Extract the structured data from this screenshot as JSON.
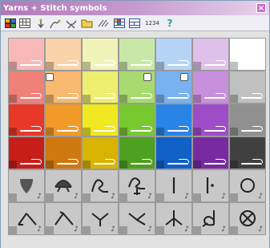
{
  "window": {
    "title": "Yarns + Stitch symbols",
    "close_glyph": "×"
  },
  "toolbar": {
    "buttons": [
      {
        "name": "palette-view-icon",
        "glyph": "▦"
      },
      {
        "name": "grid-view-icon",
        "glyph": "▩"
      },
      {
        "name": "yarn-down-icon",
        "glyph": "⇩"
      },
      {
        "name": "stitch-left-icon",
        "glyph": "⤺"
      },
      {
        "name": "stitch-both-icon",
        "glyph": "⤻"
      },
      {
        "name": "folder-open-icon",
        "glyph": "▭"
      },
      {
        "name": "swap-icon",
        "glyph": "⇄"
      },
      {
        "name": "chart-a-icon",
        "glyph": "▦"
      },
      {
        "name": "chart-b-icon",
        "glyph": "▦"
      },
      {
        "name": "numbers-label",
        "glyph": "1234"
      },
      {
        "name": "help-icon",
        "glyph": "?"
      }
    ]
  },
  "colors": {
    "rows": [
      [
        "#f8b8b8",
        "#fad3a8",
        "#f2f3b8",
        "#c9e8a8",
        "#b6d4f6",
        "#dfc0ea",
        "#ffffff"
      ],
      [
        "#f08078",
        "#f8b870",
        "#eeee70",
        "#a8da70",
        "#78b2f0",
        "#c890dc",
        "#c0c0c0"
      ],
      [
        "#e83828",
        "#f29a28",
        "#f0e820",
        "#78c830",
        "#2a84e8",
        "#9e4cc8",
        "#909090"
      ],
      [
        "#c81e1a",
        "#d07810",
        "#d8b400",
        "#4ea020",
        "#1060c8",
        "#782aa0",
        "#404040"
      ]
    ],
    "selected": [
      [
        1,
        1
      ],
      [
        1,
        3
      ],
      [
        1,
        4
      ]
    ]
  },
  "symbols": {
    "rows": [
      [
        "leaf-symbol-icon",
        "arch-symbol-icon",
        "loop-symbol-icon",
        "loop-tail-symbol-icon",
        "bar-symbol-icon",
        "bar-dot-symbol-icon",
        "circle-symbol-icon"
      ],
      [
        "caret-left-symbol-icon",
        "lambda-symbol-icon",
        "chevron-down-symbol-icon",
        "chevron-open-symbol-icon",
        "trident-symbol-icon",
        "d-curl-symbol-icon",
        "circle-x-symbol-icon"
      ]
    ],
    "note_glyph": "♪"
  }
}
